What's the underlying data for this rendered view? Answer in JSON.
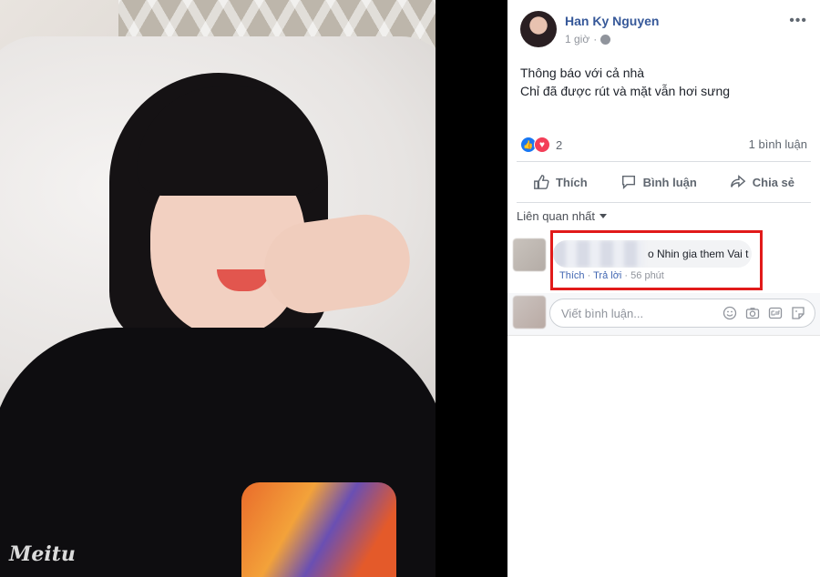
{
  "photo": {
    "watermark": "Meitu"
  },
  "post": {
    "author": "Han Ky Nguyen",
    "time": "1 giờ",
    "text_line1": "Thông báo với cả nhà",
    "text_line2": "Chỉ đã được rút và mặt vẫn hơi sưng",
    "reaction_count": "2",
    "comment_count": "1 bình luận"
  },
  "actions": {
    "like": "Thích",
    "comment": "Bình luận",
    "share": "Chia sẻ"
  },
  "comments": {
    "sort_label": "Liên quan nhất",
    "items": [
      {
        "text": "o Nhin gia them Vai t",
        "like": "Thích",
        "reply": "Trả lời",
        "time": "56 phút"
      }
    ]
  },
  "composer": {
    "placeholder": "Viết bình luận..."
  },
  "colors": {
    "link": "#365899",
    "highlight": "#e11a1a",
    "like_blue": "#1877f2",
    "love_red": "#f33e58"
  }
}
